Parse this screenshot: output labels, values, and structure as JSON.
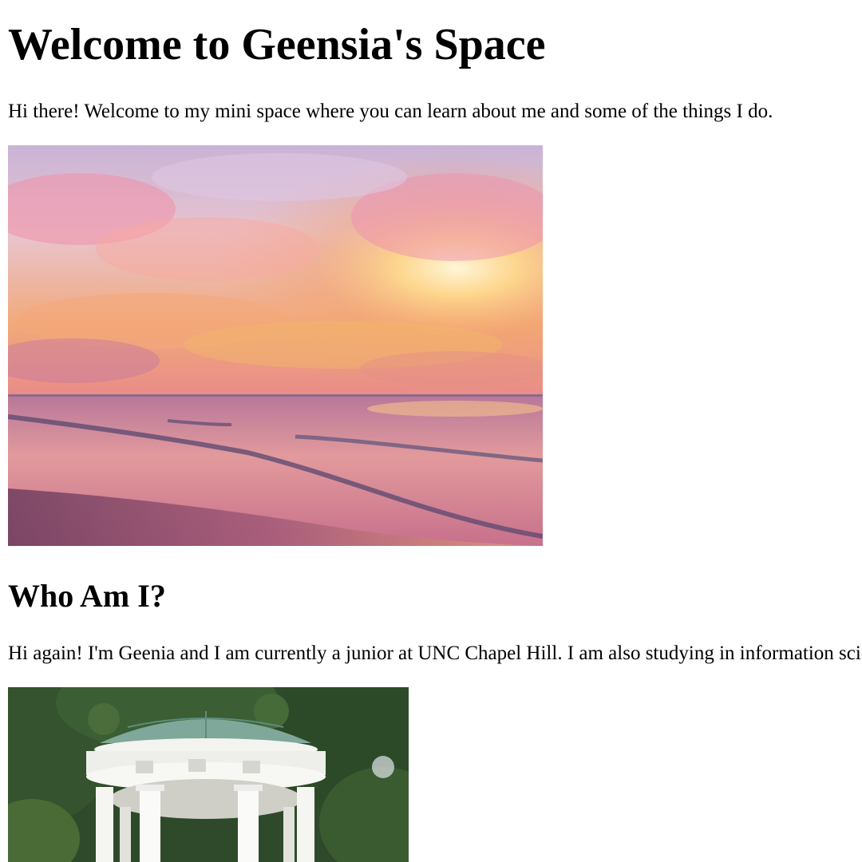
{
  "page": {
    "title": "Welcome to Geensia's Space",
    "intro": "Hi there! Welcome to my mini space where you can learn about me and some of the things I do.",
    "about_heading": "Who Am I?",
    "about_text": "Hi again! I'm Geenia and I am currently a junior at UNC Chapel Hill. I am also studying in information science"
  },
  "images": {
    "sunset": {
      "alt": "sunset over beach"
    },
    "well": {
      "alt": "Old Well gazebo"
    }
  }
}
